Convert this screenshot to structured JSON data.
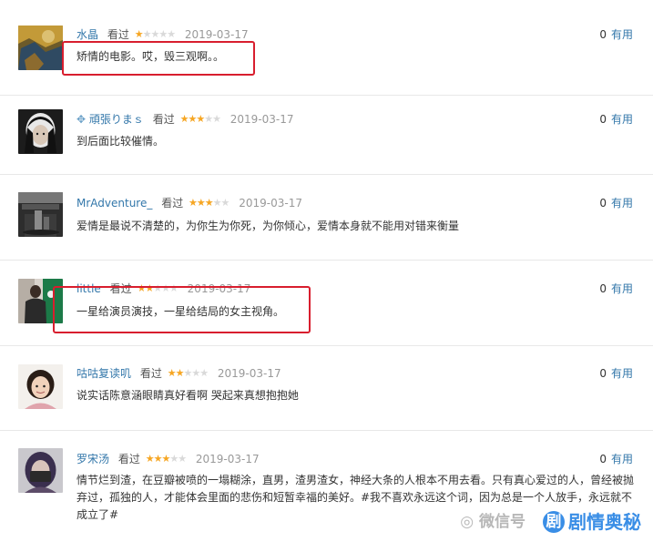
{
  "colors": {
    "link": "#3377aa",
    "star_on": "#f6a623",
    "star_off": "#d9d9d9",
    "highlight": "#d81e2e",
    "brand": "#3a8ee6"
  },
  "useful_label": "有用",
  "reviews": [
    {
      "username": "水晶",
      "status": "看过",
      "rating": 1,
      "date": "2019-03-17",
      "useful_count": "0",
      "comment": "矫情的电影。哎，毁三观啊。。",
      "highlighted": true
    },
    {
      "username": "頑張りまｓ",
      "status": "看过",
      "rating": 3,
      "date": "2019-03-17",
      "useful_count": "0",
      "comment": "到后面比较催情。",
      "highlighted": false
    },
    {
      "username": "MrAdventure_",
      "status": "看过",
      "rating": 3,
      "date": "2019-03-17",
      "useful_count": "0",
      "comment": "爱情是最说不清楚的，为你生为你死，为你倾心，爱情本身就不能用对错来衡量",
      "highlighted": false
    },
    {
      "username": "little",
      "status": "看过",
      "rating": 2,
      "date": "2019-03-17",
      "useful_count": "0",
      "comment": "一星给演员演技，一星给结局的女主视角。",
      "highlighted": true
    },
    {
      "username": "咕咕复读叽",
      "status": "看过",
      "rating": 2,
      "date": "2019-03-17",
      "useful_count": "0",
      "comment": "说实话陈意涵眼睛真好看啊 哭起来真想抱抱她",
      "highlighted": false
    },
    {
      "username": "罗宋汤",
      "status": "看过",
      "rating": 3,
      "date": "2019-03-17",
      "useful_count": "0",
      "comment": "情节烂到渣，在豆瓣被喷的一塌糊涂，直男，渣男渣女，神经大条的人根本不用去看。只有真心爱过的人，曾经被抛弃过，孤独的人，才能体会里面的悲伤和短暂幸福的美好。#我不喜欢永远这个词，因为总是一个人放手，永远就不成立了#",
      "highlighted": false
    }
  ],
  "watermark": {
    "wechat_text": "微信号",
    "brand_text": "剧情奥秘",
    "logo_glyph": "剧"
  }
}
